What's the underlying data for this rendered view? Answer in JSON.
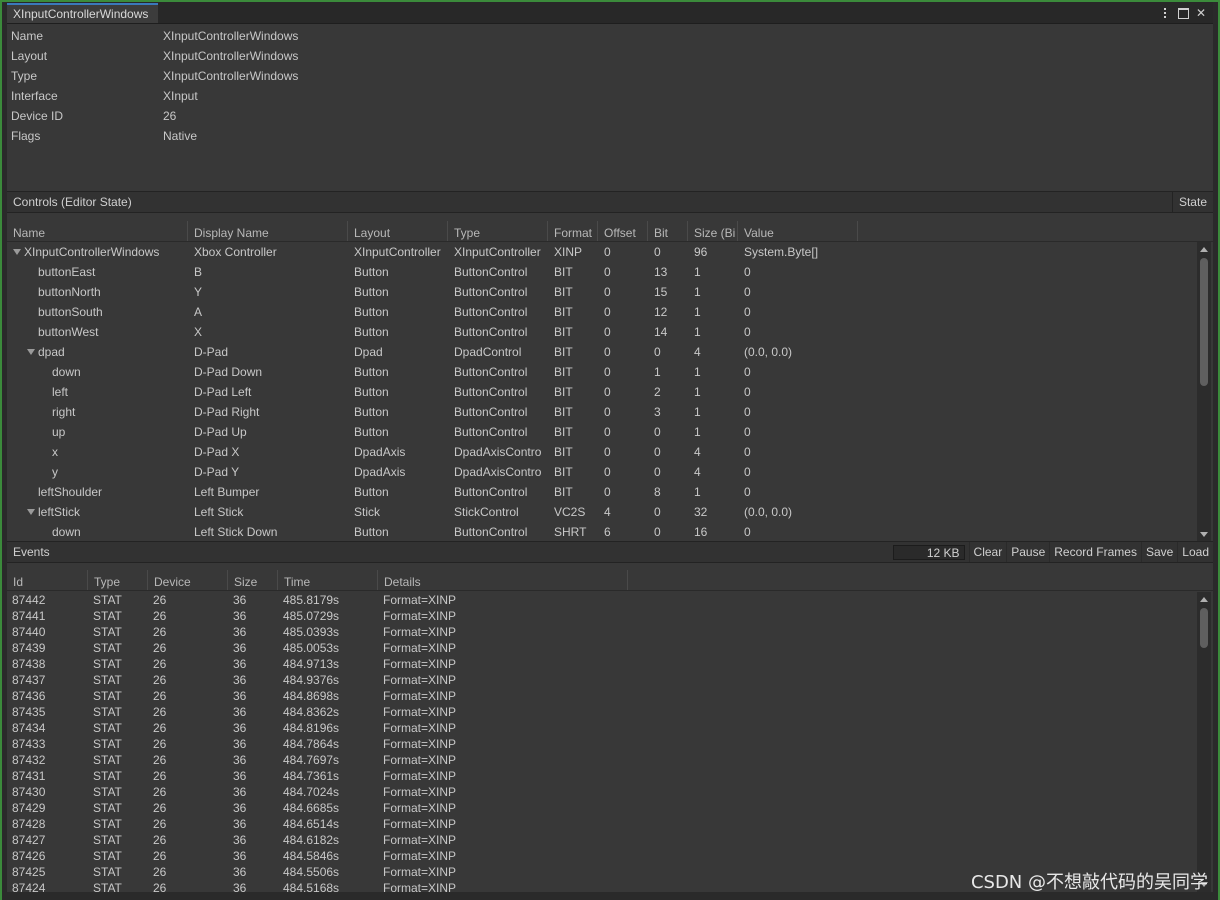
{
  "window": {
    "tab_title": "XInputControllerWindows"
  },
  "properties": [
    {
      "key": "Name",
      "value": "XInputControllerWindows"
    },
    {
      "key": "Layout",
      "value": "XInputControllerWindows"
    },
    {
      "key": "Type",
      "value": "XInputControllerWindows"
    },
    {
      "key": "Interface",
      "value": "XInput"
    },
    {
      "key": "Device ID",
      "value": "26"
    },
    {
      "key": "Flags",
      "value": "Native"
    }
  ],
  "controls": {
    "section_title": "Controls (Editor State)",
    "state_button": "State",
    "columns": [
      "Name",
      "Display Name",
      "Layout",
      "Type",
      "Format",
      "Offset",
      "Bit",
      "Size (Bi",
      "Value"
    ],
    "rows": [
      {
        "name": "XInputControllerWindows",
        "display": "Xbox Controller",
        "layout": "XInputController",
        "type": "XInputController",
        "format": "XINP",
        "offset": "0",
        "bit": "0",
        "size": "96",
        "value": "System.Byte[]",
        "depth": 0,
        "expanded": true
      },
      {
        "name": "buttonEast",
        "display": "B",
        "layout": "Button",
        "type": "ButtonControl",
        "format": "BIT",
        "offset": "0",
        "bit": "13",
        "size": "1",
        "value": "0",
        "depth": 1
      },
      {
        "name": "buttonNorth",
        "display": "Y",
        "layout": "Button",
        "type": "ButtonControl",
        "format": "BIT",
        "offset": "0",
        "bit": "15",
        "size": "1",
        "value": "0",
        "depth": 1
      },
      {
        "name": "buttonSouth",
        "display": "A",
        "layout": "Button",
        "type": "ButtonControl",
        "format": "BIT",
        "offset": "0",
        "bit": "12",
        "size": "1",
        "value": "0",
        "depth": 1
      },
      {
        "name": "buttonWest",
        "display": "X",
        "layout": "Button",
        "type": "ButtonControl",
        "format": "BIT",
        "offset": "0",
        "bit": "14",
        "size": "1",
        "value": "0",
        "depth": 1
      },
      {
        "name": "dpad",
        "display": "D-Pad",
        "layout": "Dpad",
        "type": "DpadControl",
        "format": "BIT",
        "offset": "0",
        "bit": "0",
        "size": "4",
        "value": "(0.0, 0.0)",
        "depth": 1,
        "expanded": true
      },
      {
        "name": "down",
        "display": "D-Pad Down",
        "layout": "Button",
        "type": "ButtonControl",
        "format": "BIT",
        "offset": "0",
        "bit": "1",
        "size": "1",
        "value": "0",
        "depth": 2
      },
      {
        "name": "left",
        "display": "D-Pad Left",
        "layout": "Button",
        "type": "ButtonControl",
        "format": "BIT",
        "offset": "0",
        "bit": "2",
        "size": "1",
        "value": "0",
        "depth": 2
      },
      {
        "name": "right",
        "display": "D-Pad Right",
        "layout": "Button",
        "type": "ButtonControl",
        "format": "BIT",
        "offset": "0",
        "bit": "3",
        "size": "1",
        "value": "0",
        "depth": 2
      },
      {
        "name": "up",
        "display": "D-Pad Up",
        "layout": "Button",
        "type": "ButtonControl",
        "format": "BIT",
        "offset": "0",
        "bit": "0",
        "size": "1",
        "value": "0",
        "depth": 2
      },
      {
        "name": "x",
        "display": "D-Pad X",
        "layout": "DpadAxis",
        "type": "DpadAxisContro",
        "format": "BIT",
        "offset": "0",
        "bit": "0",
        "size": "4",
        "value": "0",
        "depth": 2
      },
      {
        "name": "y",
        "display": "D-Pad Y",
        "layout": "DpadAxis",
        "type": "DpadAxisContro",
        "format": "BIT",
        "offset": "0",
        "bit": "0",
        "size": "4",
        "value": "0",
        "depth": 2
      },
      {
        "name": "leftShoulder",
        "display": "Left Bumper",
        "layout": "Button",
        "type": "ButtonControl",
        "format": "BIT",
        "offset": "0",
        "bit": "8",
        "size": "1",
        "value": "0",
        "depth": 1
      },
      {
        "name": "leftStick",
        "display": "Left Stick",
        "layout": "Stick",
        "type": "StickControl",
        "format": "VC2S",
        "offset": "4",
        "bit": "0",
        "size": "32",
        "value": "(0.0, 0.0)",
        "depth": 1,
        "expanded": true
      },
      {
        "name": "down",
        "display": "Left Stick Down",
        "layout": "Button",
        "type": "ButtonControl",
        "format": "SHRT",
        "offset": "6",
        "bit": "0",
        "size": "16",
        "value": "0",
        "depth": 2
      }
    ]
  },
  "events": {
    "section_title": "Events",
    "size_readout": "12 KB",
    "buttons": [
      "Clear",
      "Pause",
      "Record Frames",
      "Save",
      "Load"
    ],
    "columns": [
      "Id",
      "Type",
      "Device",
      "Size",
      "Time",
      "Details"
    ],
    "rows": [
      {
        "id": "87442",
        "type": "STAT",
        "device": "26",
        "size": "36",
        "time": "485.8179s",
        "details": "Format=XINP"
      },
      {
        "id": "87441",
        "type": "STAT",
        "device": "26",
        "size": "36",
        "time": "485.0729s",
        "details": "Format=XINP"
      },
      {
        "id": "87440",
        "type": "STAT",
        "device": "26",
        "size": "36",
        "time": "485.0393s",
        "details": "Format=XINP"
      },
      {
        "id": "87439",
        "type": "STAT",
        "device": "26",
        "size": "36",
        "time": "485.0053s",
        "details": "Format=XINP"
      },
      {
        "id": "87438",
        "type": "STAT",
        "device": "26",
        "size": "36",
        "time": "484.9713s",
        "details": "Format=XINP"
      },
      {
        "id": "87437",
        "type": "STAT",
        "device": "26",
        "size": "36",
        "time": "484.9376s",
        "details": "Format=XINP"
      },
      {
        "id": "87436",
        "type": "STAT",
        "device": "26",
        "size": "36",
        "time": "484.8698s",
        "details": "Format=XINP"
      },
      {
        "id": "87435",
        "type": "STAT",
        "device": "26",
        "size": "36",
        "time": "484.8362s",
        "details": "Format=XINP"
      },
      {
        "id": "87434",
        "type": "STAT",
        "device": "26",
        "size": "36",
        "time": "484.8196s",
        "details": "Format=XINP"
      },
      {
        "id": "87433",
        "type": "STAT",
        "device": "26",
        "size": "36",
        "time": "484.7864s",
        "details": "Format=XINP"
      },
      {
        "id": "87432",
        "type": "STAT",
        "device": "26",
        "size": "36",
        "time": "484.7697s",
        "details": "Format=XINP"
      },
      {
        "id": "87431",
        "type": "STAT",
        "device": "26",
        "size": "36",
        "time": "484.7361s",
        "details": "Format=XINP"
      },
      {
        "id": "87430",
        "type": "STAT",
        "device": "26",
        "size": "36",
        "time": "484.7024s",
        "details": "Format=XINP"
      },
      {
        "id": "87429",
        "type": "STAT",
        "device": "26",
        "size": "36",
        "time": "484.6685s",
        "details": "Format=XINP"
      },
      {
        "id": "87428",
        "type": "STAT",
        "device": "26",
        "size": "36",
        "time": "484.6514s",
        "details": "Format=XINP"
      },
      {
        "id": "87427",
        "type": "STAT",
        "device": "26",
        "size": "36",
        "time": "484.6182s",
        "details": "Format=XINP"
      },
      {
        "id": "87426",
        "type": "STAT",
        "device": "26",
        "size": "36",
        "time": "484.5846s",
        "details": "Format=XINP"
      },
      {
        "id": "87425",
        "type": "STAT",
        "device": "26",
        "size": "36",
        "time": "484.5506s",
        "details": "Format=XINP"
      },
      {
        "id": "87424",
        "type": "STAT",
        "device": "26",
        "size": "36",
        "time": "484.5168s",
        "details": "Format=XINP"
      }
    ]
  },
  "watermark": "CSDN @不想敲代码的吴同学",
  "icons": {
    "menu": "kebab-menu-icon",
    "maximize": "maximize-icon"
  }
}
